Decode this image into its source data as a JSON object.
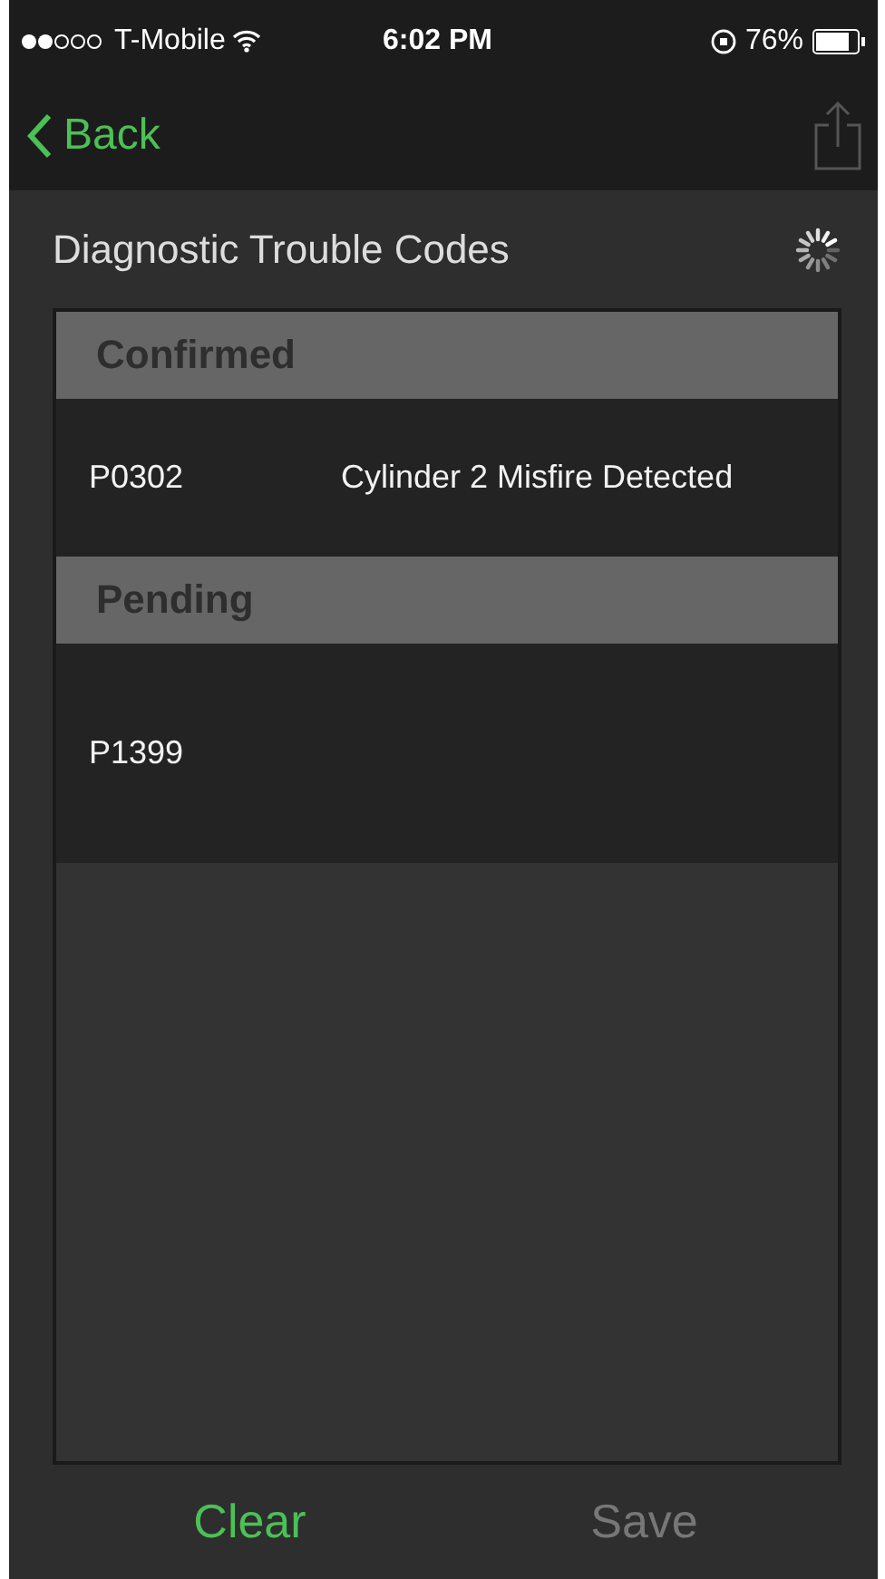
{
  "status_bar": {
    "carrier": "T-Mobile",
    "time": "6:02 PM",
    "battery": "76%"
  },
  "nav": {
    "back_label": "Back"
  },
  "title": "Diagnostic Trouble Codes",
  "sections": [
    {
      "title": "Confirmed",
      "rows": [
        {
          "code": "P0302",
          "description": "Cylinder 2 Misfire Detected"
        }
      ]
    },
    {
      "title": "Pending",
      "rows": [
        {
          "code": "P1399"
        }
      ]
    }
  ],
  "buttons": [
    {
      "label": "Clear",
      "disabled": false
    },
    {
      "label": "Save",
      "disabled": true
    }
  ]
}
